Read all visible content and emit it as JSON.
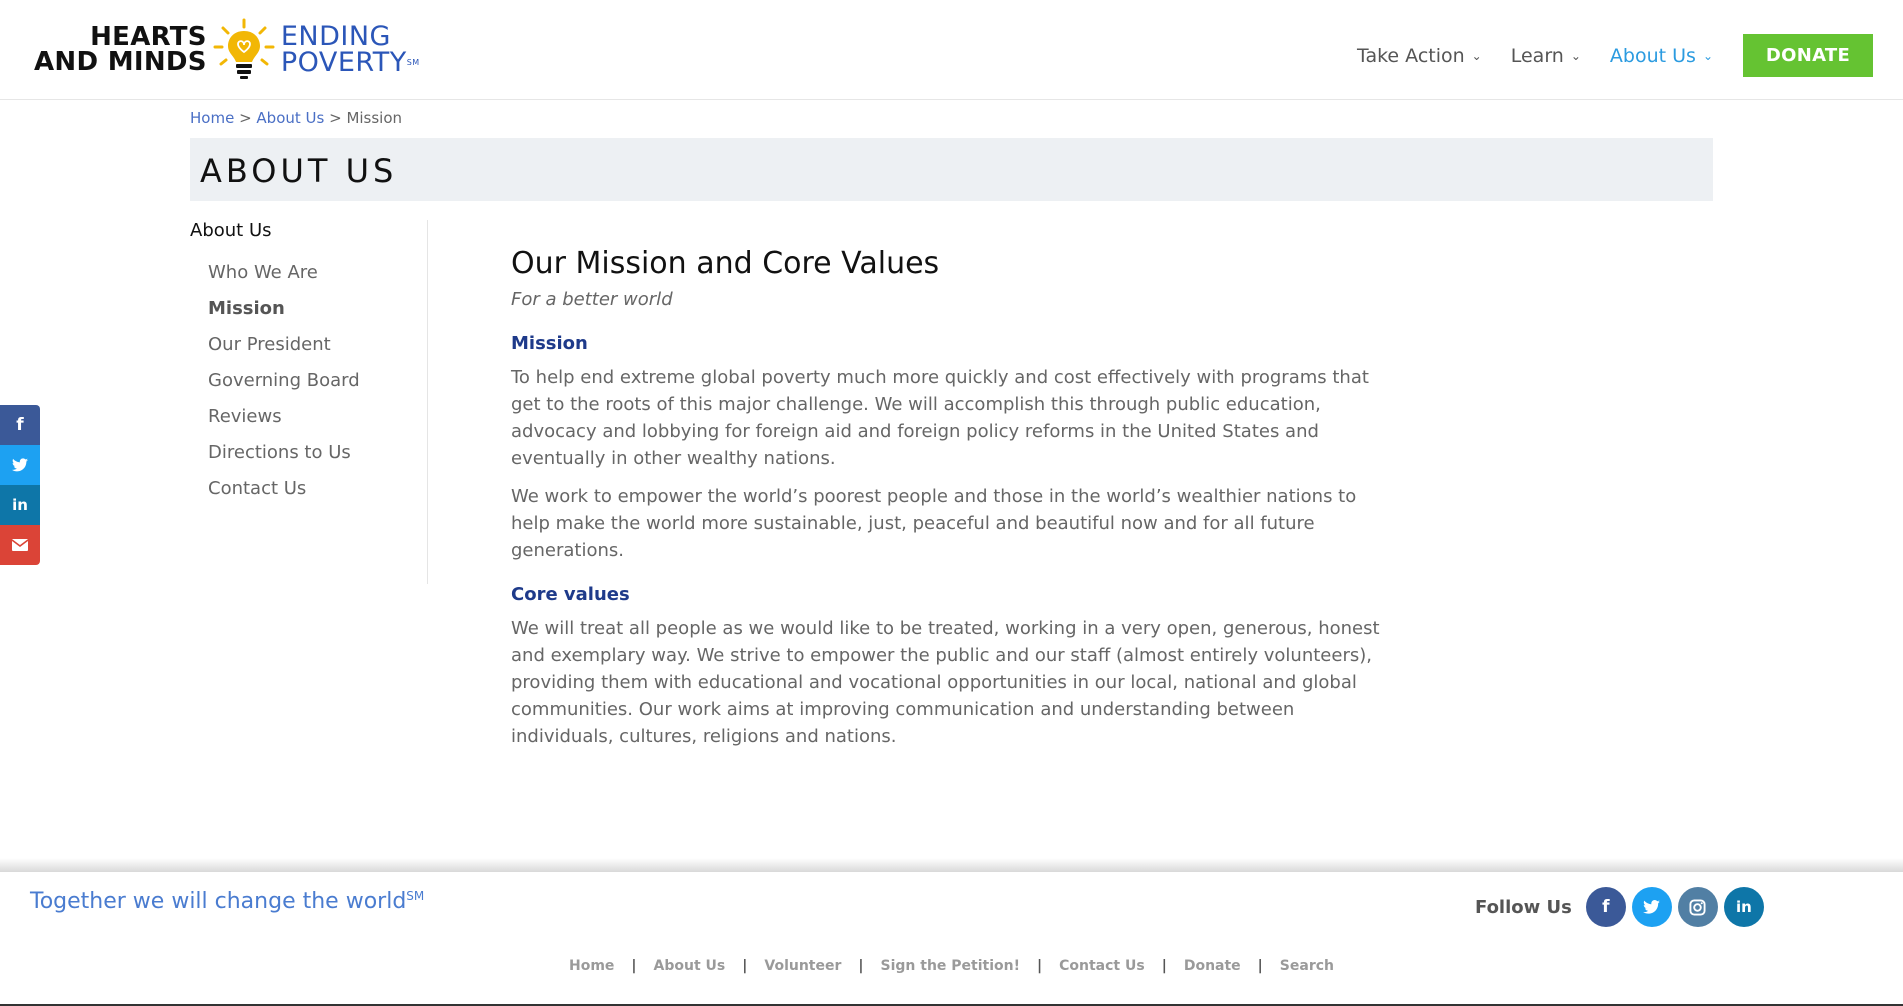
{
  "header": {
    "logo_left_line1": "HEARTS",
    "logo_left_line2": "AND MINDS",
    "logo_right_line1": "ENDING",
    "logo_right_line2": "POVERTY",
    "logo_mark": "SM",
    "nav": [
      {
        "label": "Take Action"
      },
      {
        "label": "Learn"
      },
      {
        "label": "About Us"
      }
    ],
    "donate_label": "DONATE",
    "accent": "#2b9be0",
    "donate_color": "#65c332"
  },
  "breadcrumb": {
    "home": "Home",
    "sep1": " > ",
    "about": "About Us",
    "sep2": " > ",
    "current": "Mission"
  },
  "page_title": "ABOUT US",
  "sidebar": {
    "title": "About Us",
    "items": [
      {
        "label": "Who We Are"
      },
      {
        "label": "Mission"
      },
      {
        "label": "Our President"
      },
      {
        "label": "Governing Board"
      },
      {
        "label": "Reviews"
      },
      {
        "label": "Directions to Us"
      },
      {
        "label": "Contact Us"
      }
    ]
  },
  "main": {
    "heading": "Our Mission and Core Values",
    "subtitle": "For a better world",
    "section1_title": "Mission",
    "p1": "To help end extreme global poverty much more quickly and cost effectively with programs that get to the roots of this major challenge. We will accomplish this through public education, advocacy and lobbying for foreign aid and foreign policy reforms in the United States and eventually in other wealthy nations.",
    "p2": "We work to empower the world’s poorest people and those in the world’s wealthier nations to help make the world more sustainable, just, peaceful and beautiful now and for all future generations.",
    "section2_title": "Core values",
    "p3": "We will treat all people as we would like to be treated, working in a very open, generous, honest and exemplary way. We strive to empower the public and our staff (almost entirely volunteers), providing them with educational and vocational opportunities in our local, national and global communities. Our work aims at improving communication and understanding between individuals, cultures, religions and nations."
  },
  "share": {
    "facebook_icon": "facebook-icon",
    "twitter_icon": "twitter-icon",
    "linkedin_icon": "linkedin-icon",
    "email_icon": "email-icon"
  },
  "footer": {
    "tagline": "Together we will change the world",
    "tagline_mark": "SM",
    "follow_label": "Follow Us",
    "links": [
      {
        "label": "Home"
      },
      {
        "label": "About Us"
      },
      {
        "label": "Volunteer"
      },
      {
        "label": "Sign the Petition!"
      },
      {
        "label": "Contact Us"
      },
      {
        "label": "Donate"
      },
      {
        "label": "Search"
      }
    ],
    "separator": "|"
  }
}
